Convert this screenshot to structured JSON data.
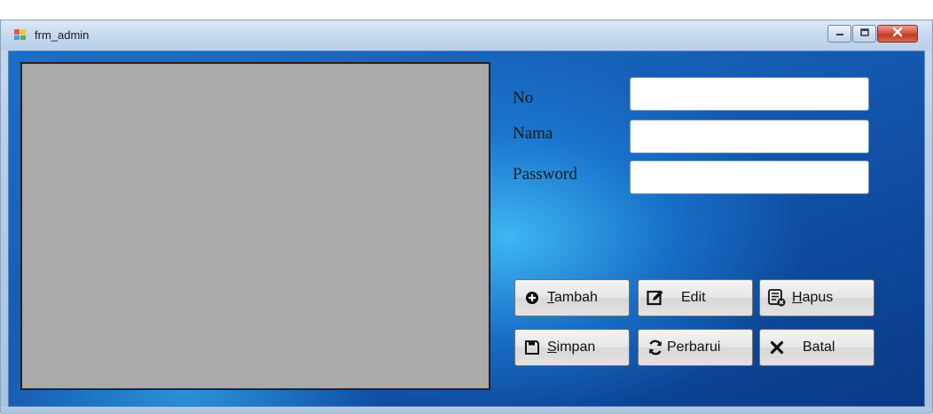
{
  "window": {
    "title": "frm_admin",
    "icon": "form-icon",
    "controls": [
      "minimize-icon",
      "maximize-icon",
      "close-icon"
    ]
  },
  "form": {
    "labels": {
      "no": "No",
      "nama": "Nama",
      "password": "Password"
    },
    "fields": {
      "no": {
        "value": "",
        "placeholder": ""
      },
      "nama": {
        "value": "",
        "placeholder": ""
      },
      "password": {
        "value": "",
        "placeholder": ""
      }
    }
  },
  "buttons": {
    "tambah": {
      "mnemonic": "T",
      "rest": "ambah",
      "icon": "plus-circle-icon"
    },
    "edit": {
      "label": "Edit",
      "icon": "edit-icon"
    },
    "hapus": {
      "mnemonic": "H",
      "rest": "apus",
      "icon": "delete-list-icon"
    },
    "simpan": {
      "mnemonic": "S",
      "rest": "impan",
      "icon": "save-icon"
    },
    "perbarui": {
      "label": "Perbarui",
      "icon": "refresh-icon"
    },
    "batal": {
      "label": "Batal",
      "icon": "x-icon"
    }
  },
  "colors": {
    "client_bg": "#1660b8",
    "picture_bg": "#aaaaaa"
  }
}
